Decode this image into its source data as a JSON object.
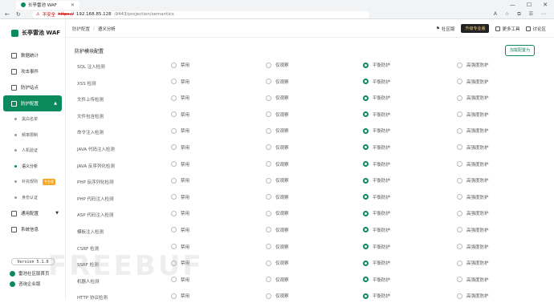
{
  "browser": {
    "tab_title": "长亭雷池 WAF",
    "insecure_label": "不安全",
    "url_scheme": "https://",
    "url_host": "192.168.85.128",
    "url_path": ":9443/projection/semantics"
  },
  "sidebar": {
    "app_name": "长亭雷池 WAF",
    "items": [
      {
        "label": "数据统计"
      },
      {
        "label": "攻击事件"
      },
      {
        "label": "防护站点"
      },
      {
        "label": "防护配置"
      },
      {
        "label": "通用配置"
      },
      {
        "label": "系统信息"
      }
    ],
    "sub_items": [
      {
        "label": "黑白名单"
      },
      {
        "label": "频率限制"
      },
      {
        "label": "人机验证"
      },
      {
        "label": "语义分析"
      },
      {
        "label": "补充规则"
      },
      {
        "label": "身份认证"
      }
    ],
    "pro_badge": "专业版",
    "version": "Version 5.1.0",
    "community_link": "雷池社区版首页",
    "enterprise_link": "咨询企业版"
  },
  "topbar": {
    "breadcrumb_parent": "防护配置",
    "breadcrumb_sep": "/",
    "breadcrumb_current": "语义分析",
    "community_edition": "社区版",
    "upgrade": "升级专业版",
    "tools": "更多工具",
    "forum": "讨论区"
  },
  "content": {
    "title": "防护模块配置",
    "add_button": "加载配置为"
  },
  "options": [
    "禁用",
    "仅观察",
    "平衡防护",
    "高强度防护"
  ],
  "colors": {
    "accent": "#0b8a5e"
  },
  "modules": [
    {
      "name": "SQL 注入检测",
      "selected": 2
    },
    {
      "name": "XSS 检测",
      "selected": 2
    },
    {
      "name": "文件上传检测",
      "selected": 2
    },
    {
      "name": "文件包含检测",
      "selected": 2
    },
    {
      "name": "命令注入检测",
      "selected": 2
    },
    {
      "name": "JAVA 代码注入检测",
      "selected": 2
    },
    {
      "name": "JAVA 反序列化检测",
      "selected": 2
    },
    {
      "name": "PHP 反序列化检测",
      "selected": 2
    },
    {
      "name": "PHP 代码注入检测",
      "selected": 2
    },
    {
      "name": "ASP 代码注入检测",
      "selected": 2
    },
    {
      "name": "模板注入检测",
      "selected": 2
    },
    {
      "name": "CSRF 检测",
      "selected": 2
    },
    {
      "name": "SSRF 检测",
      "selected": 2
    },
    {
      "name": "机器人检测",
      "selected": 2
    },
    {
      "name": "HTTP 协议检测",
      "selected": 2
    }
  ],
  "watermark": "FREEBUF"
}
